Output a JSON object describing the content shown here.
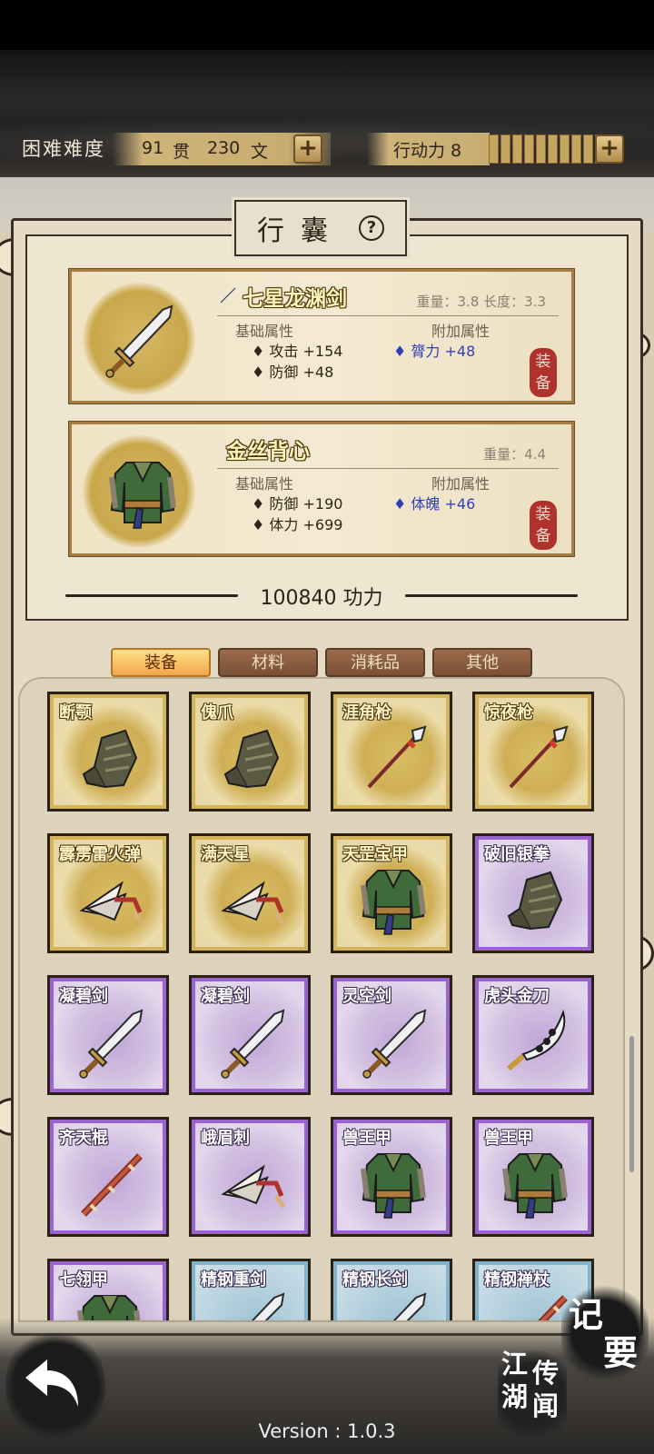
{
  "topbar": {
    "difficulty_label": "困难难度",
    "money_guan": "91",
    "money_guan_unit": "贯",
    "money_wen": "230",
    "money_wen_unit": "文",
    "add_money_label": "+",
    "energy_label": "行动力 8",
    "energy_segments": 10,
    "add_energy_label": "+"
  },
  "bag": {
    "title": "行囊",
    "help_label": "?"
  },
  "equipped": [
    {
      "name": "七星龙渊剑",
      "meta": "重量：3.8  长度：3.3",
      "base_header": "基础属性",
      "bonus_header": "附加属性",
      "stats": [
        "♦ 攻击 +154",
        "♦ 防御 +48"
      ],
      "bonus": "♦ 膂力 +48",
      "badge": "装备",
      "icon": "sword-icon"
    },
    {
      "name": "金丝背心",
      "meta": "重量：4.4",
      "base_header": "基础属性",
      "bonus_header": "附加属性",
      "stats": [
        "♦ 防御 +190",
        "♦ 体力 +699"
      ],
      "bonus": "♦ 体魄 +46",
      "badge": "装备",
      "icon": "armor-icon"
    }
  ],
  "power_text": "100840 功力",
  "tabs": [
    {
      "label": "装备",
      "active": true
    },
    {
      "label": "材料",
      "active": false
    },
    {
      "label": "消耗品",
      "active": false
    },
    {
      "label": "其他",
      "active": false
    }
  ],
  "items": [
    {
      "name": "断颚",
      "rarity": "gold",
      "icon": "gauntlet-icon"
    },
    {
      "name": "傀爪",
      "rarity": "gold",
      "icon": "gauntlet-icon"
    },
    {
      "name": "涯角枪",
      "rarity": "gold",
      "icon": "spear-icon"
    },
    {
      "name": "惊夜枪",
      "rarity": "gold",
      "icon": "spear-icon"
    },
    {
      "name": "霹雳雷火弹",
      "rarity": "gold",
      "icon": "dart-icon"
    },
    {
      "name": "满天星",
      "rarity": "gold",
      "icon": "dart-icon"
    },
    {
      "name": "天罡宝甲",
      "rarity": "gold",
      "icon": "armor-icon"
    },
    {
      "name": "破旧银拳",
      "rarity": "purple",
      "icon": "gauntlet-icon"
    },
    {
      "name": "凝碧剑",
      "rarity": "purple",
      "icon": "sword-icon"
    },
    {
      "name": "凝碧剑",
      "rarity": "purple",
      "icon": "sword-icon"
    },
    {
      "name": "灵空剑",
      "rarity": "purple",
      "icon": "sword-icon"
    },
    {
      "name": "虎头金刀",
      "rarity": "purple",
      "icon": "saber-icon"
    },
    {
      "name": "齐天棍",
      "rarity": "purple",
      "icon": "staff-icon"
    },
    {
      "name": "峨眉刺",
      "rarity": "purple",
      "icon": "dart-icon"
    },
    {
      "name": "兽王甲",
      "rarity": "purple",
      "icon": "armor-icon"
    },
    {
      "name": "兽王甲",
      "rarity": "purple",
      "icon": "armor-icon"
    },
    {
      "name": "七翎甲",
      "rarity": "purple",
      "icon": "armor-icon"
    },
    {
      "name": "精钢重剑",
      "rarity": "blue",
      "icon": "sword-icon"
    },
    {
      "name": "精钢长剑",
      "rarity": "blue",
      "icon": "sword-icon"
    },
    {
      "name": "精钢禅杖",
      "rarity": "blue",
      "icon": "staff-icon"
    }
  ],
  "footer": {
    "version": "Version : 1.0.3",
    "journal_char1": "记",
    "journal_char2": "要",
    "news_chars": [
      "江",
      "湖",
      "传",
      "闻"
    ]
  },
  "colors": {
    "gold_frame": "#d4b45a",
    "purple_frame": "#9b63d1",
    "blue_frame": "#82b3cf",
    "bonus_text": "#2f3fb5",
    "equip_badge": "#b0322c"
  }
}
